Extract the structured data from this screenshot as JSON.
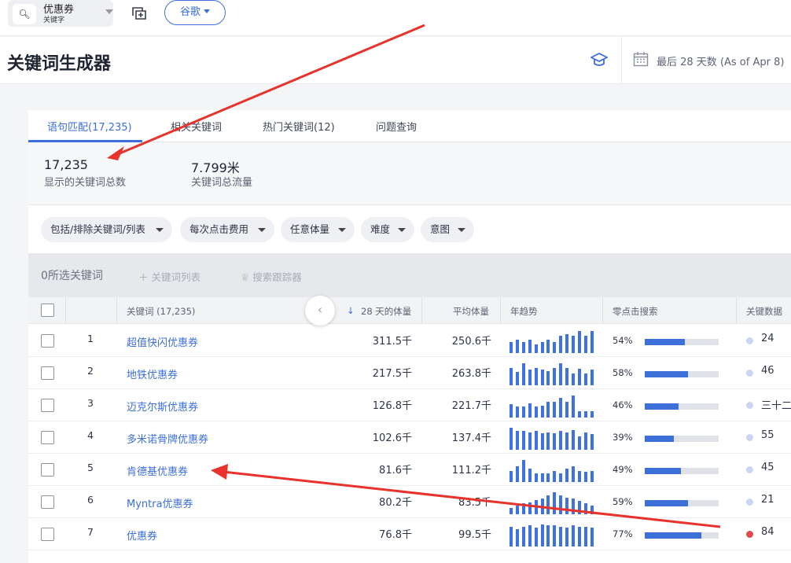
{
  "search": {
    "term": "优惠券",
    "scope": "关键字",
    "icon": "search-icon"
  },
  "engine": {
    "label": "谷歌"
  },
  "header": {
    "title": "关键词生成器",
    "date_range": "最后 28 天数 (As of Apr 8)"
  },
  "tabs": [
    {
      "label": "语句匹配(17,235)",
      "active": true
    },
    {
      "label": "相关关键词",
      "active": false
    },
    {
      "label": "热门关键词(12)",
      "active": false
    },
    {
      "label": "问题查询",
      "active": false
    }
  ],
  "metrics": [
    {
      "value": "17,235",
      "label": "显示的关键词总数"
    },
    {
      "value": "7.799米",
      "label": "关键词总流量"
    }
  ],
  "filters": [
    {
      "label": "包括/排除关键词/列表"
    },
    {
      "label": "每次点击费用"
    },
    {
      "label": "任意体量"
    },
    {
      "label": "难度"
    },
    {
      "label": "意图"
    }
  ],
  "selection": {
    "count_label": "0所选关键词",
    "add_list": "关键词列表",
    "track": "搜索跟踪器"
  },
  "columns": {
    "keyword": "关键词 (17,235)",
    "volume": "28 天的体量",
    "avg": "平均体量",
    "trend": "年趋势",
    "zero_click": "零点击搜索",
    "kd": "关键数据"
  },
  "colors": {
    "accent": "#3d6fd8",
    "kd_low": "#c9d6f2",
    "kd_high": "#e5484d",
    "annotation": "#e8322c"
  },
  "rows": [
    {
      "num": "1",
      "keyword": "超值快闪优惠券",
      "volume": "311.5千",
      "avg": "250.6千",
      "zc_pct": "54%",
      "zc": 0.54,
      "kd": "24",
      "kd_level": "low",
      "trend": [
        0.5,
        0.6,
        0.5,
        0.6,
        0.4,
        0.5,
        0.6,
        0.5,
        0.8,
        0.85,
        0.8,
        1.0,
        0.8,
        1.0
      ]
    },
    {
      "num": "2",
      "keyword": "地铁优惠券",
      "volume": "217.5千",
      "avg": "263.8千",
      "zc_pct": "58%",
      "zc": 0.58,
      "kd": "46",
      "kd_level": "low",
      "trend": [
        0.8,
        0.6,
        1.0,
        0.7,
        0.8,
        0.7,
        0.65,
        0.8,
        1.0,
        0.8,
        0.55,
        0.75,
        0.55,
        0.7
      ]
    },
    {
      "num": "3",
      "keyword": "迈克尔斯优惠券",
      "volume": "126.8千",
      "avg": "221.7千",
      "zc_pct": "46%",
      "zc": 0.46,
      "kd": "三十二",
      "kd_level": "low",
      "trend": [
        0.6,
        0.5,
        0.5,
        0.65,
        0.5,
        0.55,
        0.7,
        0.7,
        0.9,
        0.7,
        1.0,
        0.3,
        0.3,
        0.3
      ]
    },
    {
      "num": "4",
      "keyword": "多米诺骨牌优惠券",
      "volume": "102.6千",
      "avg": "137.4千",
      "zc_pct": "39%",
      "zc": 0.39,
      "kd": "55",
      "kd_level": "low",
      "trend": [
        1.0,
        0.85,
        0.85,
        0.8,
        0.85,
        0.75,
        0.8,
        0.75,
        0.85,
        0.8,
        0.9,
        0.6,
        0.8,
        0.7
      ]
    },
    {
      "num": "5",
      "keyword": "肯德基优惠券",
      "volume": "81.6千",
      "avg": "111.2千",
      "zc_pct": "49%",
      "zc": 0.49,
      "kd": "45",
      "kd_level": "low",
      "trend": [
        0.5,
        0.7,
        1.0,
        0.6,
        0.4,
        0.4,
        0.4,
        0.5,
        0.4,
        0.6,
        0.7,
        0.5,
        0.45,
        0.5
      ]
    },
    {
      "num": "6",
      "keyword": "Myntra优惠券",
      "volume": "80.2千",
      "avg": "83.5千",
      "zc_pct": "59%",
      "zc": 0.59,
      "kd": "21",
      "kd_level": "low",
      "trend": [
        0.3,
        0.4,
        0.5,
        0.55,
        0.65,
        0.7,
        0.85,
        1.0,
        0.85,
        0.75,
        0.7,
        0.6,
        0.5,
        0.4
      ]
    },
    {
      "num": "7",
      "keyword": "优惠券",
      "volume": "76.8千",
      "avg": "99.5千",
      "zc_pct": "77%",
      "zc": 0.77,
      "kd": "84",
      "kd_level": "high",
      "trend": [
        0.9,
        0.8,
        0.9,
        0.95,
        0.85,
        1.0,
        0.95,
        0.95,
        0.9,
        0.85,
        0.95,
        0.9,
        0.9,
        0.85
      ]
    }
  ]
}
